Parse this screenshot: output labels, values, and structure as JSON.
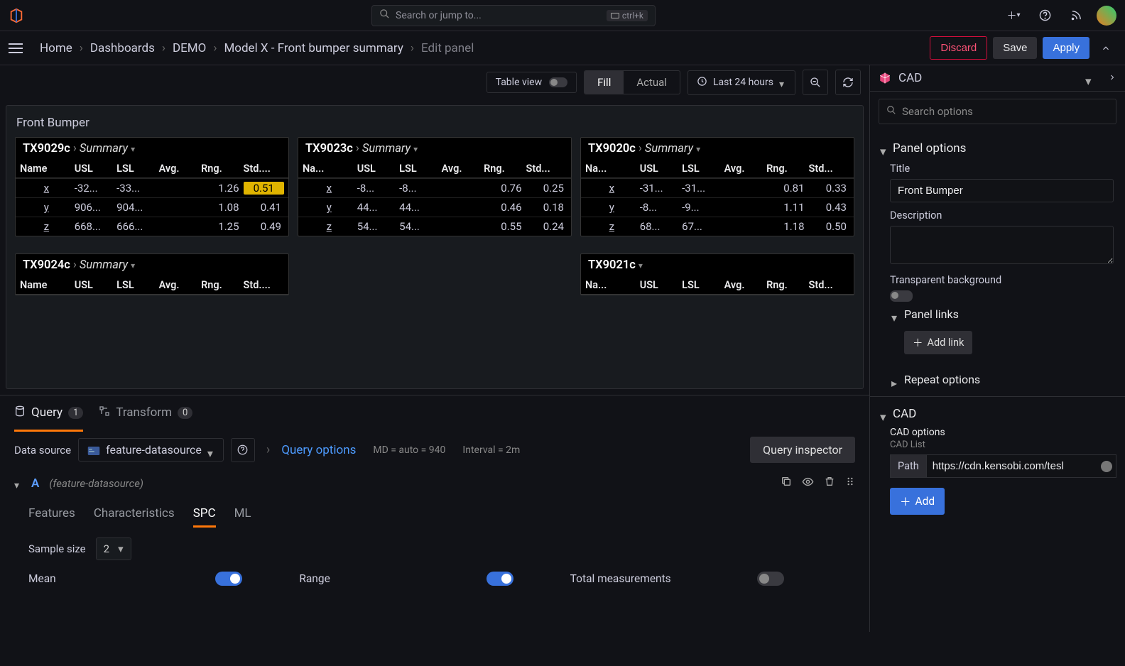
{
  "topbar": {
    "search_placeholder": "Search or jump to...",
    "shortcut": "ctrl+k"
  },
  "breadcrumb": {
    "items": [
      "Home",
      "Dashboards",
      "DEMO",
      "Model X - Front bumper summary"
    ],
    "current": "Edit panel"
  },
  "nav_actions": {
    "discard": "Discard",
    "save": "Save",
    "apply": "Apply"
  },
  "toolbar": {
    "table_view": "Table view",
    "fill": "Fill",
    "actual": "Actual",
    "time_range": "Last 24 hours"
  },
  "panel": {
    "title": "Front Bumper",
    "columns": [
      "Name",
      "USL",
      "LSL",
      "Avg.",
      "Rng.",
      "Std...."
    ],
    "columns_trunc": [
      "Na...",
      "USL",
      "LSL",
      "Avg.",
      "Rng.",
      "Std..."
    ],
    "tables": [
      {
        "code": "TX9029c",
        "sub": "Summary",
        "rows": [
          {
            "name": "x",
            "usl": "-32...",
            "lsl": "-33...",
            "avg": "",
            "rng": "1.26",
            "std": "0.51",
            "hl": true
          },
          {
            "name": "y",
            "usl": "906...",
            "lsl": "904...",
            "avg": "",
            "rng": "1.08",
            "std": "0.41"
          },
          {
            "name": "z",
            "usl": "668...",
            "lsl": "666...",
            "avg": "",
            "rng": "1.25",
            "std": "0.49"
          }
        ]
      },
      {
        "code": "TX9023c",
        "sub": "Summary",
        "rows": [
          {
            "name": "x",
            "usl": "-8...",
            "lsl": "-8...",
            "avg": "",
            "rng": "0.76",
            "std": "0.25"
          },
          {
            "name": "y",
            "usl": "44...",
            "lsl": "44...",
            "avg": "",
            "rng": "0.46",
            "std": "0.18"
          },
          {
            "name": "z",
            "usl": "54...",
            "lsl": "54...",
            "avg": "",
            "rng": "0.55",
            "std": "0.24"
          }
        ]
      },
      {
        "code": "TX9020c",
        "sub": "Summary",
        "rows": [
          {
            "name": "x",
            "usl": "-31...",
            "lsl": "-31...",
            "avg": "",
            "rng": "0.81",
            "std": "0.33"
          },
          {
            "name": "y",
            "usl": "-8...",
            "lsl": "-9...",
            "avg": "",
            "rng": "1.11",
            "std": "0.43"
          },
          {
            "name": "z",
            "usl": "68...",
            "lsl": "67...",
            "avg": "",
            "rng": "1.18",
            "std": "0.50"
          }
        ]
      },
      {
        "code": "TX9024c",
        "sub": "Summary",
        "header_only": true
      },
      {
        "code": "TX9021c",
        "sub": "",
        "header_only": true
      }
    ]
  },
  "query_tabs": {
    "query": "Query",
    "query_count": "1",
    "transform": "Transform",
    "transform_count": "0"
  },
  "ds": {
    "label": "Data source",
    "name": "feature-datasource",
    "query_options": "Query options",
    "md": "MD = auto = 940",
    "interval": "Interval = 2m",
    "inspector": "Query inspector"
  },
  "query": {
    "letter": "A",
    "subtitle": "(feature-datasource)",
    "tabs": [
      "Features",
      "Characteristics",
      "SPC",
      "ML"
    ],
    "sample_size_label": "Sample size",
    "sample_size_value": "2",
    "switches": {
      "mean": "Mean",
      "range": "Range",
      "total": "Total measurements"
    }
  },
  "right": {
    "header": "CAD",
    "search_placeholder": "Search options",
    "panel_options": "Panel options",
    "title_label": "Title",
    "title_value": "Front Bumper",
    "description_label": "Description",
    "transparent_label": "Transparent background",
    "panel_links": "Panel links",
    "add_link": "Add link",
    "repeat_options": "Repeat options",
    "cad_section": "CAD",
    "cad_options": "CAD options",
    "cad_list": "CAD List",
    "path_label": "Path",
    "path_value": "https://cdn.kensobi.com/tesl",
    "add_btn": "Add"
  }
}
